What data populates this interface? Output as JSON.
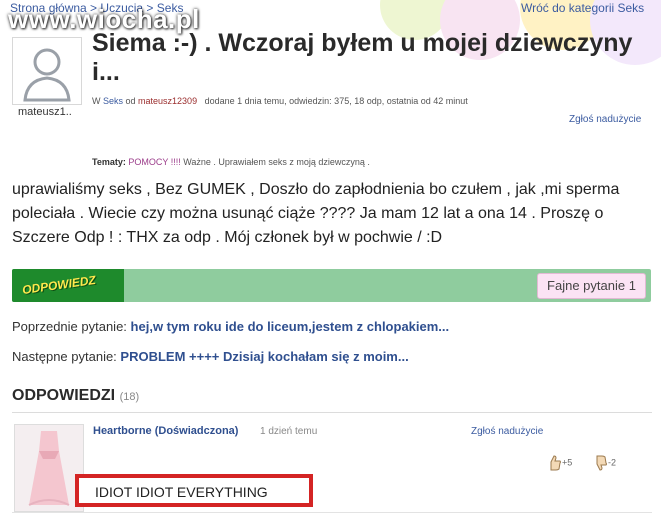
{
  "breadcrumb": {
    "home": "Strona główna",
    "sep": " > ",
    "cat1": "Uczucia",
    "cat2": "Seks"
  },
  "back_link": "Wróć do kategorii Seks",
  "watermark": "www.wiocha.pl",
  "author": {
    "name": "mateusz1.."
  },
  "question": {
    "title": "Siema :-) . Wczoraj byłem u mojej dziewczyny i...",
    "meta": {
      "in_prefix": "W ",
      "category": "Seks",
      "by_prefix": " od ",
      "user": "mateusz12309",
      "stats": "dodane 1 dnia temu, odwiedzin: 375, 18 odp, ostatnia od 42 minut"
    },
    "report_label": "Zgłoś nadużycie",
    "topics_label": "Tematy:",
    "topics_value1": "POMOCY !!!!",
    "topics_value2": " Ważne . Uprawiałem seks z moją dziewczyną .",
    "body": "uprawialiśmy seks , Bez GUMEK , Doszło do zapłodnienia bo czułem , jak ,mi sperma poleciała . Wiecie czy można usunąć ciąże ???? Ja mam 12 lat a ona 14 . Proszę o Szczere Odp ! : THX za odp . Mój członek był w pochwie / :D"
  },
  "actions": {
    "answer_button": "ODPOWIEDZ",
    "nice_question": "Fajne pytanie 1"
  },
  "navigation": {
    "prev_label": "Poprzednie pytanie:",
    "prev_question": "hej,w tym roku ide do liceum,jestem z chlopakiem...",
    "next_label": "Następne pytanie:",
    "next_question": "PROBLEM ++++ Dzisiaj kochałam się z moim..."
  },
  "answers": {
    "heading": "ODPOWIEDZI",
    "count": "(18)",
    "items": [
      {
        "author": "Heartborne (Doświadczona)",
        "time": "1 dzień temu",
        "report_label": "Zgłoś nadużycie",
        "votes_up": "+5",
        "votes_down": "-2",
        "text": "IDIOT IDIOT EVERYTHING"
      }
    ]
  },
  "colors": {
    "link": "#3b5ba0",
    "answer_green": "#1e8a2c",
    "bar_green": "#8fcc9e",
    "highlight_red": "#d42424"
  }
}
